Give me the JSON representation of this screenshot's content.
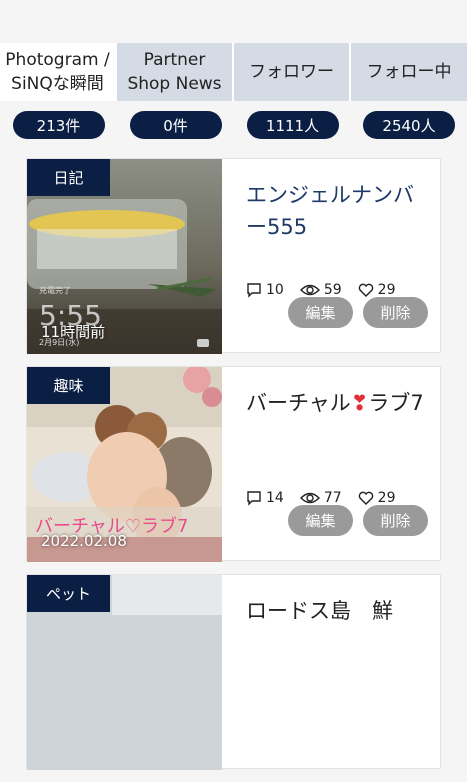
{
  "tabs": [
    {
      "label": "Photogram /\nSiNQな瞬間"
    },
    {
      "label": "Partner\nShop News"
    },
    {
      "label": "フォロワー"
    },
    {
      "label": "フォロー中"
    }
  ],
  "counts": [
    "213件",
    "0件",
    "1111人",
    "2540人"
  ],
  "posts": [
    {
      "category": "日記",
      "title": "エンジェルナンバー555",
      "thumb_caption": "11時間前",
      "thumb_overlay_time": "5:55",
      "thumb_overlay_top": "充電完了",
      "thumb_overlay_date": "2月9日(水)",
      "comments": "10",
      "views": "59",
      "likes": "29",
      "edit": "編集",
      "delete": "削除"
    },
    {
      "category": "趣味",
      "title_part1": "バーチャル",
      "title_part2": "ラブ7",
      "thumb_caption": "2022.02.08",
      "thumb_overlay_text": "バーチャル♡ラブ7",
      "comments": "14",
      "views": "77",
      "likes": "29",
      "edit": "編集",
      "delete": "削除"
    },
    {
      "category": "ペット",
      "title": "ロードス島　鮮"
    }
  ],
  "colors": {
    "navy": "#0b1f44",
    "tab_bg": "#d5dbe4",
    "button_gray": "#9a9a9a"
  }
}
